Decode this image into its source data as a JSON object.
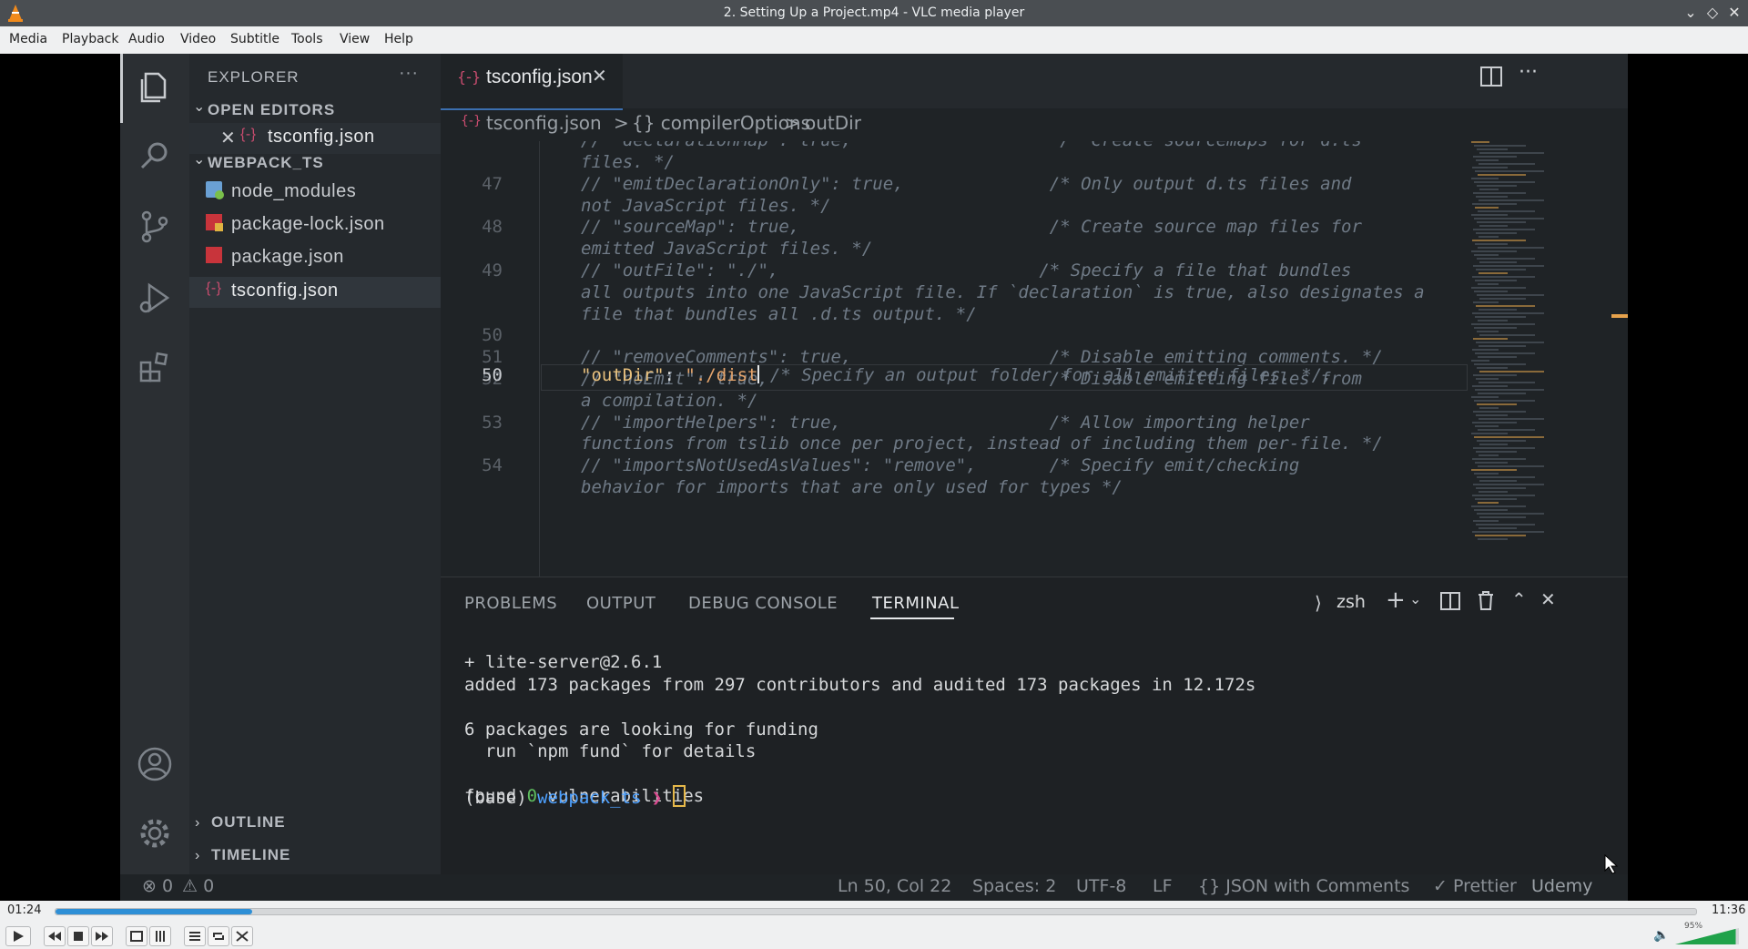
{
  "window": {
    "title": "2. Setting Up a Project.mp4 - VLC media player"
  },
  "menu": [
    "Media",
    "Playback",
    "Audio",
    "Video",
    "Subtitle",
    "Tools",
    "View",
    "Help"
  ],
  "vscode": {
    "sidebar": {
      "explorer_title": "EXPLORER",
      "open_editors_header": "OPEN EDITORS",
      "open_editor_file": "tsconfig.json",
      "project_header": "WEBPACK_TS",
      "files": [
        "node_modules",
        "package-lock.json",
        "package.json",
        "tsconfig.json"
      ],
      "outline": "OUTLINE",
      "timeline": "TIMELINE"
    },
    "tab": {
      "label": "tsconfig.json"
    },
    "breadcrumb": {
      "file": "tsconfig.json",
      "sep1": ">",
      "section": "{} compilerOptions",
      "sep2": ">",
      "leaf": "outDir"
    },
    "code": {
      "top_partial": "// \"declarationMap\": true,                    /* Create sourcemaps for d.ts",
      "lines": [
        {
          "n": "",
          "text": "files. */"
        },
        {
          "n": "47",
          "text": "// \"emitDeclarationOnly\": true,              /* Only output d.ts files and"
        },
        {
          "n": "",
          "text": "not JavaScript files. */"
        },
        {
          "n": "48",
          "text": "// \"sourceMap\": true,                        /* Create source map files for"
        },
        {
          "n": "",
          "text": "emitted JavaScript files. */"
        },
        {
          "n": "49",
          "text": "// \"outFile\": \"./\",                         /* Specify a file that bundles"
        },
        {
          "n": "",
          "text": "all outputs into one JavaScript file. If `declaration` is true, also designates a"
        },
        {
          "n": "",
          "text": "file that bundles all .d.ts output. */"
        },
        {
          "n": "50",
          "text": ""
        },
        {
          "n": "51",
          "text": "// \"removeComments\": true,                   /* Disable emitting comments. */"
        },
        {
          "n": "52",
          "text": "// \"noEmit\": true,                           /* Disable emitting files from"
        },
        {
          "n": "",
          "text": "a compilation. */"
        },
        {
          "n": "53",
          "text": "// \"importHelpers\": true,                    /* Allow importing helper"
        },
        {
          "n": "",
          "text": "functions from tslib once per project, instead of including them per-file. */"
        },
        {
          "n": "54",
          "text": "// \"importsNotUsedAsValues\": \"remove\",       /* Specify emit/checking"
        },
        {
          "n": "",
          "text": "behavior for imports that are only used for types */"
        }
      ],
      "active_key": "\"outDir\"",
      "active_colon": ": ",
      "active_value": "\"./dist",
      "active_comment": " /* Specify an output folder for all emitted files. */,"
    },
    "panel": {
      "tabs": [
        "PROBLEMS",
        "OUTPUT",
        "DEBUG CONSOLE",
        "TERMINAL"
      ],
      "shell": "zsh",
      "terminal": [
        "+ lite-server@2.6.1",
        "added 173 packages from 297 contributors and audited 173 packages in 12.172s",
        "",
        "6 packages are looking for funding",
        "  run `npm fund` for details",
        "",
        "found 0 vulnerabilities"
      ],
      "prompt_prefix": "(base) ",
      "prompt_dir": "webpack_ts",
      "prompt_arrow": " ❯ "
    },
    "status": {
      "errors": "0",
      "warnings": "0",
      "position": "Ln 50, Col 22",
      "spaces": "Spaces: 2",
      "encoding": "UTF-8",
      "eol": "LF",
      "language": "{} JSON with Comments",
      "prettier": "✓ Prettier",
      "watermark": "Udemy"
    }
  },
  "player": {
    "elapsed": "01:24",
    "total": "11:36",
    "progress": 0.12,
    "volume_label": "95%",
    "volume": 0.95
  },
  "colors": {
    "accent": "#3b6fb0",
    "json_key": "#e8c07d",
    "json_string": "#e6a56c",
    "terminal_dir": "#4ea1ff",
    "progress": "#2e8fd6",
    "volume": "#1fa24a"
  }
}
